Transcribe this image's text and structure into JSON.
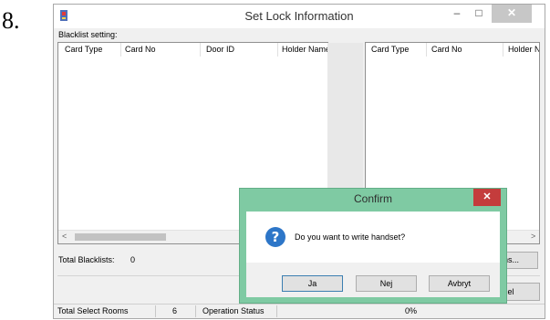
{
  "step_number": "8.",
  "window": {
    "title": "Set Lock Information",
    "minimize_glyph": "–",
    "maximize_glyph": "□",
    "close_glyph": "✕"
  },
  "blacklist": {
    "label": "Blacklist setting:",
    "left_columns": [
      "Card Type",
      "Card No",
      "Door ID",
      "Holder Name"
    ],
    "right_columns": [
      "Card Type",
      "Card No",
      "Holder N"
    ],
    "total_label": "Total Blacklists:",
    "total_value": "0"
  },
  "scroll": {
    "left_arrow": "<",
    "right_arrow": ">"
  },
  "buttons": {
    "options_partial": "ons...",
    "cancel_partial": "ncel"
  },
  "status": {
    "total_rooms_label": "Total Select Rooms",
    "total_rooms_value": "6",
    "operation_label": "Operation Status",
    "progress": "0%"
  },
  "dialog": {
    "title": "Confirm",
    "close_glyph": "✕",
    "icon": "question-icon",
    "icon_glyph": "?",
    "message": "Do you want to write handset?",
    "yes": "Ja",
    "no": "Nej",
    "cancel": "Avbryt"
  },
  "colors": {
    "dialog_frame": "#7fcaa3",
    "dialog_close": "#c43c3c",
    "question_icon": "#2d76c8"
  }
}
